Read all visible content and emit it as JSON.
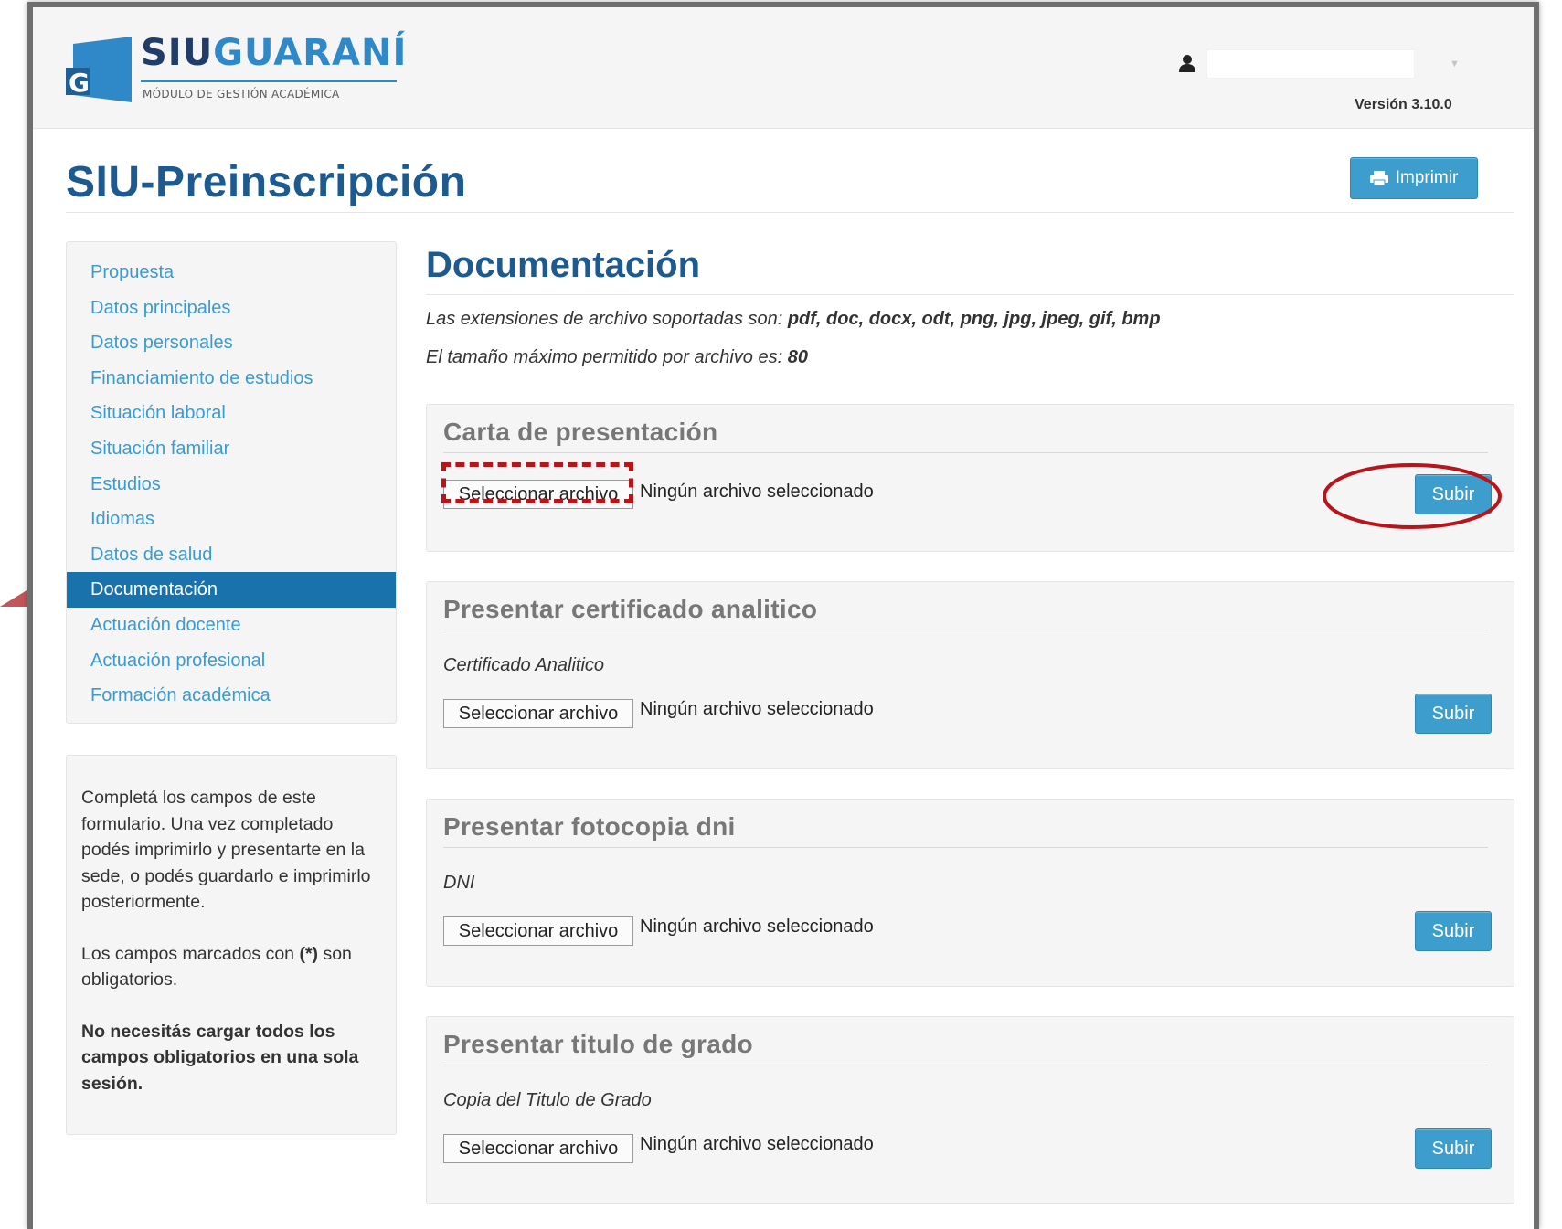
{
  "header": {
    "logo_text_primary": "SIU",
    "logo_text_secondary": "GUARANÍ",
    "logo_subtitle": "MÓDULO DE GESTIÓN ACADÉMICA",
    "user_icon": "user-icon",
    "user_name": "",
    "version": "Versión 3.10.0"
  },
  "page": {
    "title": "SIU-Preinscripción",
    "print_label": "Imprimir",
    "print_icon": "printer-icon"
  },
  "sidebar": {
    "items": [
      {
        "label": "Propuesta",
        "active": false
      },
      {
        "label": "Datos principales",
        "active": false
      },
      {
        "label": "Datos personales",
        "active": false
      },
      {
        "label": "Financiamiento de estudios",
        "active": false
      },
      {
        "label": "Situación laboral",
        "active": false
      },
      {
        "label": "Situación familiar",
        "active": false
      },
      {
        "label": "Estudios",
        "active": false
      },
      {
        "label": "Idiomas",
        "active": false
      },
      {
        "label": "Datos de salud",
        "active": false
      },
      {
        "label": "Documentación",
        "active": true
      },
      {
        "label": "Actuación docente",
        "active": false
      },
      {
        "label": "Actuación profesional",
        "active": false
      },
      {
        "label": "Formación académica",
        "active": false
      }
    ]
  },
  "help": {
    "para1": "Completá los campos de este formulario. Una vez completado podés imprimirlo y presentarte en la sede, o podés guardarlo e imprimirlo posteriormente.",
    "para2_prefix": "Los campos marcados con ",
    "para2_mark": "(*)",
    "para2_suffix": " son obligatorios.",
    "para3": "No necesitás cargar todos los campos obligatorios en una sola sesión."
  },
  "main": {
    "section_title": "Documentación",
    "extensions_label": "Las extensiones de archivo soportadas son: ",
    "extensions_value": "pdf, doc, docx, odt, png, jpg, jpeg, gif, bmp",
    "maxsize_label": "El tamaño máximo permitido por archivo es: ",
    "maxsize_value": "80",
    "documents": [
      {
        "title": "Carta de presentación",
        "description": "",
        "file_button": "Seleccionar archivo",
        "file_status": "Ningún archivo seleccionado",
        "upload": "Subir"
      },
      {
        "title": "Presentar certificado analitico",
        "description": "Certificado Analitico",
        "file_button": "Seleccionar archivo",
        "file_status": "Ningún archivo seleccionado",
        "upload": "Subir"
      },
      {
        "title": "Presentar fotocopia dni",
        "description": "DNI",
        "file_button": "Seleccionar archivo",
        "file_status": "Ningún archivo seleccionado",
        "upload": "Subir"
      },
      {
        "title": "Presentar titulo de grado",
        "description": "Copia del Titulo de Grado",
        "file_button": "Seleccionar archivo",
        "file_status": "Ningún archivo seleccionado",
        "upload": "Subir"
      }
    ]
  },
  "colors": {
    "brand_dark": "#1d5a8f",
    "link": "#3a9ad2",
    "active_nav": "#1a72ad",
    "button": "#3d9dcc",
    "annotation": "#b8151b"
  }
}
